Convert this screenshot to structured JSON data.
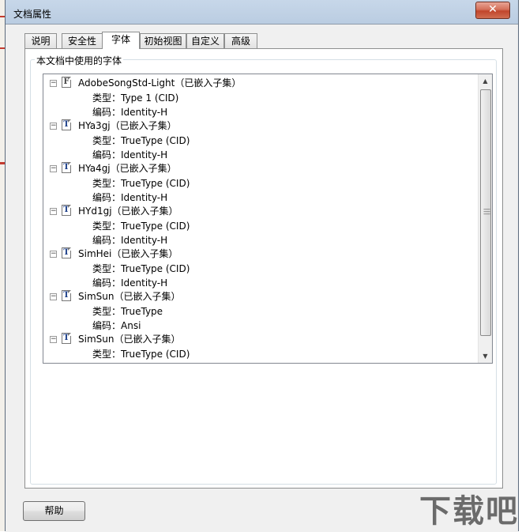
{
  "window": {
    "title": "文档属性",
    "close_glyph": "✕"
  },
  "tabs": [
    {
      "label": "说明"
    },
    {
      "label": "安全性"
    },
    {
      "label": "字体",
      "active": true
    },
    {
      "label": "初始视图"
    },
    {
      "label": "自定义"
    },
    {
      "label": "高级"
    }
  ],
  "group_label": "本文档中使用的字体",
  "fonts": [
    {
      "name": "AdobeSongStd-Light（已嵌入子集）",
      "icon": "type1-font-icon",
      "type": "类型：Type 1 (CID)",
      "encoding": "编码：Identity-H"
    },
    {
      "name": "HYa3gj（已嵌入子集）",
      "icon": "truetype-font-icon",
      "type": "类型：TrueType (CID)",
      "encoding": "编码：Identity-H"
    },
    {
      "name": "HYa4gj（已嵌入子集）",
      "icon": "truetype-font-icon",
      "type": "类型：TrueType (CID)",
      "encoding": "编码：Identity-H"
    },
    {
      "name": "HYd1gj（已嵌入子集）",
      "icon": "truetype-font-icon",
      "type": "类型：TrueType (CID)",
      "encoding": "编码：Identity-H"
    },
    {
      "name": "SimHei（已嵌入子集）",
      "icon": "truetype-font-icon",
      "type": "类型：TrueType (CID)",
      "encoding": "编码：Identity-H"
    },
    {
      "name": "SimSun（已嵌入子集）",
      "icon": "truetype-font-icon",
      "type": "类型：TrueType",
      "encoding": "编码：Ansi"
    },
    {
      "name": "SimSun（已嵌入子集）",
      "icon": "truetype-font-icon",
      "type": "类型：TrueType (CID)",
      "encoding": ""
    }
  ],
  "help_button": "帮助",
  "watermark": "下载吧"
}
